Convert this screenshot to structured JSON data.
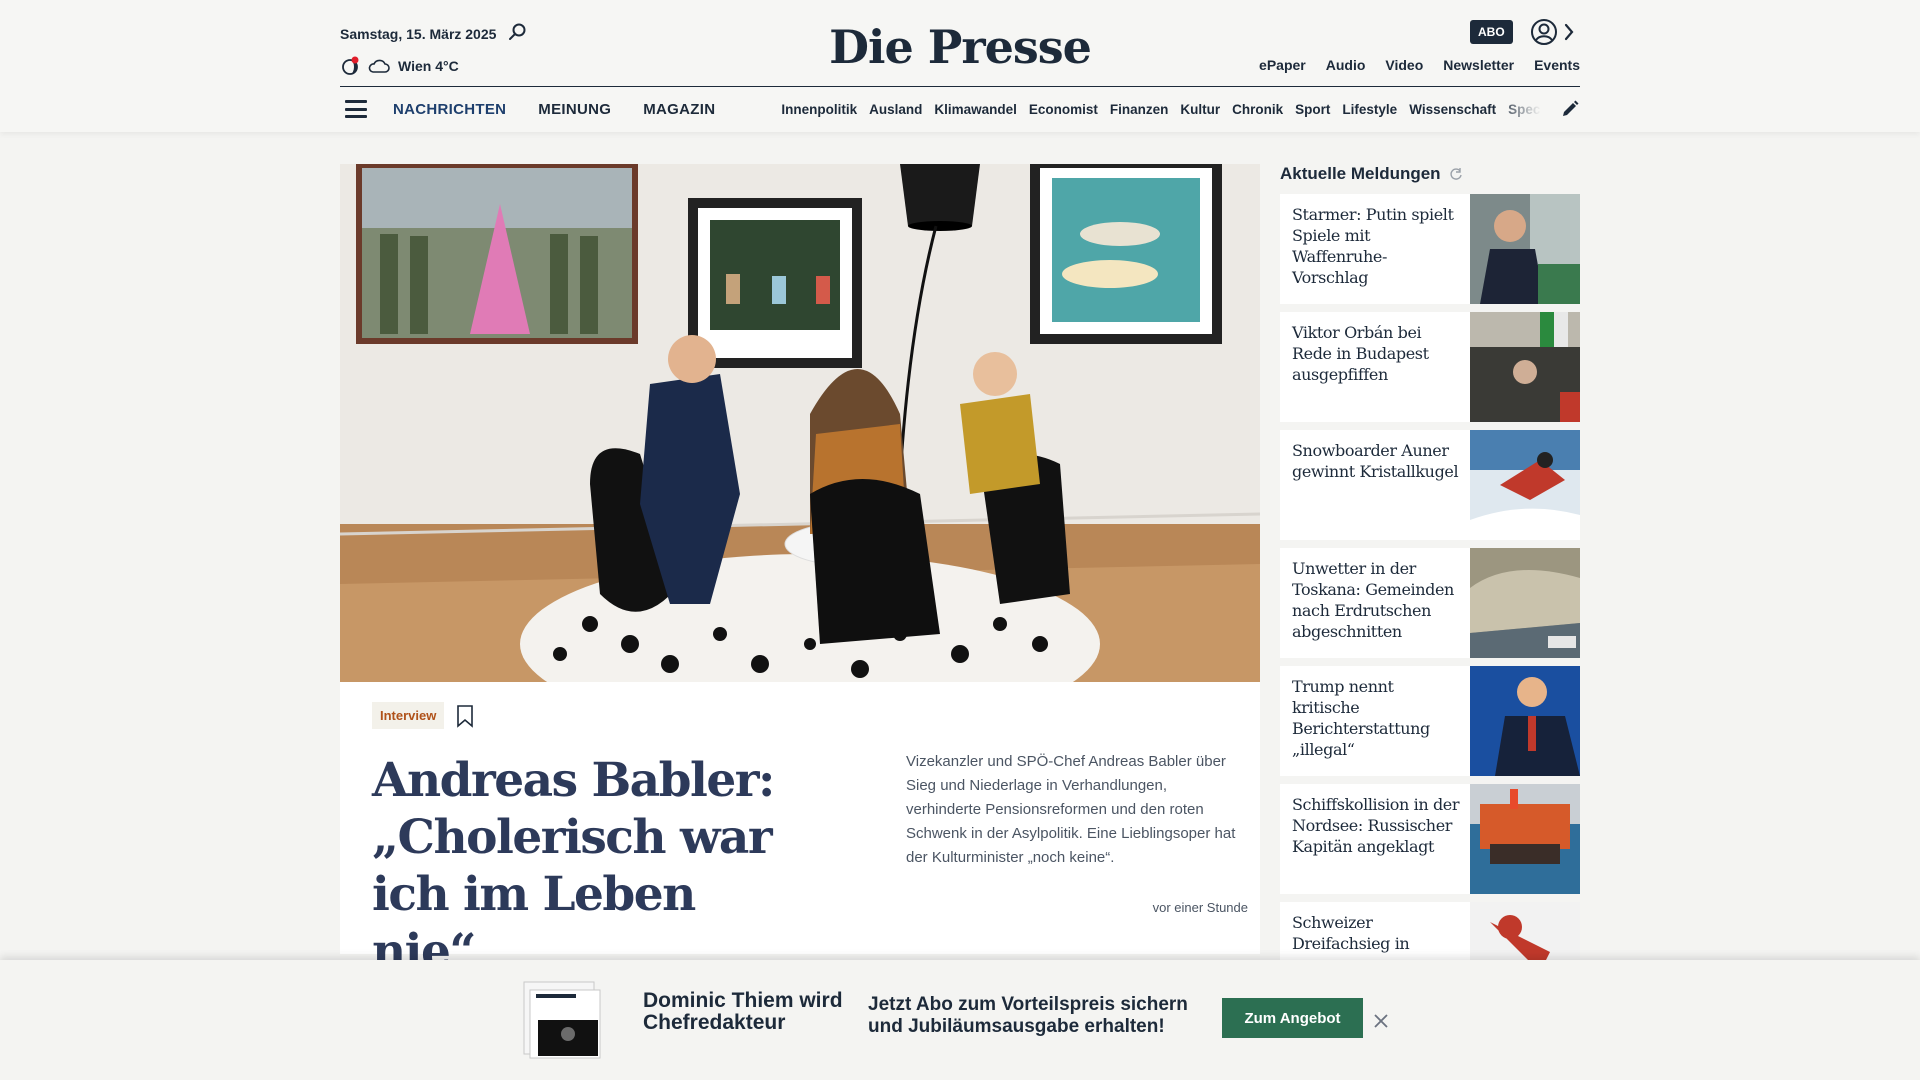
{
  "header": {
    "date": "Samstag, 15. März 2025",
    "weather": "Wien 4°C",
    "logo": "Die Presse",
    "abo_label": "ABO",
    "top_links": [
      "ePaper",
      "Audio",
      "Video",
      "Newsletter",
      "Events"
    ]
  },
  "nav": {
    "main": [
      "NACHRICHTEN",
      "MEINUNG",
      "MAGAZIN"
    ],
    "sub": [
      "Innenpolitik",
      "Ausland",
      "Klimawandel",
      "Economist",
      "Finanzen",
      "Kultur",
      "Chronik",
      "Sport",
      "Lifestyle",
      "Wissenschaft",
      "Spectrum"
    ]
  },
  "article": {
    "tag": "Interview",
    "headline": "Andreas Babler: „Cholerisch war ich im Leben nie“",
    "teaser": "Vizekanzler und SPÖ-Chef Andreas Babler über Sieg und Niederlage in Verhandlungen, verhinderte Pensionsreformen und den roten Schwenk in der Asylpolitik. Eine Lieblingsoper hat der Kulturminister „noch keine“.",
    "timestamp": "vor einer Stunde"
  },
  "sidebar": {
    "title": "Aktuelle Meldungen",
    "items": [
      {
        "title": "Starmer: Putin spielt Spiele mit Waffenruhe-Vorschlag"
      },
      {
        "title": "Viktor Orbán bei Rede in Budapest ausgepfiffen"
      },
      {
        "title": "Snowboarder Auner gewinnt Kristallkugel"
      },
      {
        "title": "Unwetter in der Toskana: Gemeinden nach Erdrutschen abgeschnitten"
      },
      {
        "title": "Trump nennt kritische Berichterstattung „illegal“"
      },
      {
        "title": "Schiffskollision in der Nordsee: Russischer Kapitän angeklagt"
      },
      {
        "title": "Schweizer Dreifachsieg in"
      }
    ]
  },
  "banner": {
    "headline": "Dominic Thiem wird Chefredakteur",
    "text": "Jetzt Abo zum Vorteilspreis sichern und Jubiläumsausgabe erhalten!",
    "cta": "Zum Angebot"
  },
  "colors": {
    "brand": "#1d2a3a",
    "tag_text": "#b0521a",
    "cta": "#2c6f52"
  }
}
